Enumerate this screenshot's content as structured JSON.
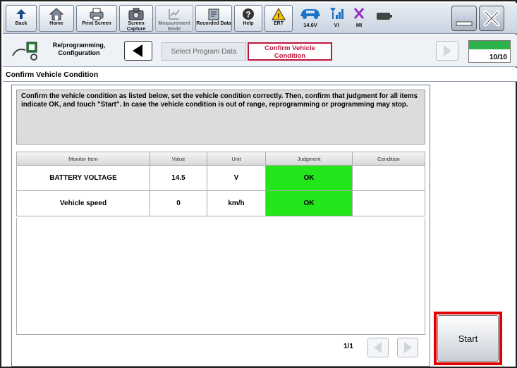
{
  "toolbar": {
    "buttons": [
      {
        "label": "Back",
        "icon": "back-arrow-icon"
      },
      {
        "label": "Home",
        "icon": "home-icon"
      },
      {
        "label": "Print Screen",
        "icon": "printer-icon"
      },
      {
        "label": "Screen Capture",
        "icon": "camera-icon"
      },
      {
        "label": "Measurement Mode",
        "icon": "measurement-icon"
      },
      {
        "label": "Recorded Data",
        "icon": "recorded-data-icon"
      },
      {
        "label": "Help",
        "icon": "help-icon"
      },
      {
        "label": "ERT",
        "icon": "warning-icon"
      }
    ],
    "status": {
      "voltage": "14.6V",
      "vi": "VI",
      "mi": "MI"
    }
  },
  "breadcrumb": {
    "home_label": "Re/programming, Configuration",
    "previous_step": "Select Program Data",
    "current_step": "Confirm Vehicle Condition",
    "progress_text": "10/10",
    "progress_fraction": 1.0
  },
  "screen_title": "Confirm Vehicle Condition",
  "instructions": "Confirm the vehicle condition as listed below, set the vehicle condition correctly. Then, confirm that judgment for all items indicate OK, and touch \"Start\". In case the vehicle condition is out of range, reprogramming or programming may stop.",
  "table": {
    "headers": [
      "Monitor Item",
      "Value",
      "Unit",
      "Judgment",
      "Condition"
    ],
    "rows": [
      {
        "item": "BATTERY VOLTAGE",
        "value": "14.5",
        "unit": "V",
        "judgment": "OK",
        "condition": ""
      },
      {
        "item": "Vehicle speed",
        "value": "0",
        "unit": "km/h",
        "judgment": "OK",
        "condition": ""
      }
    ]
  },
  "pager": {
    "text": "1/1"
  },
  "start_label": "Start",
  "colors": {
    "judgment_ok": "#22e61a",
    "current_step": "#c0143c",
    "highlight": "#e00000"
  }
}
